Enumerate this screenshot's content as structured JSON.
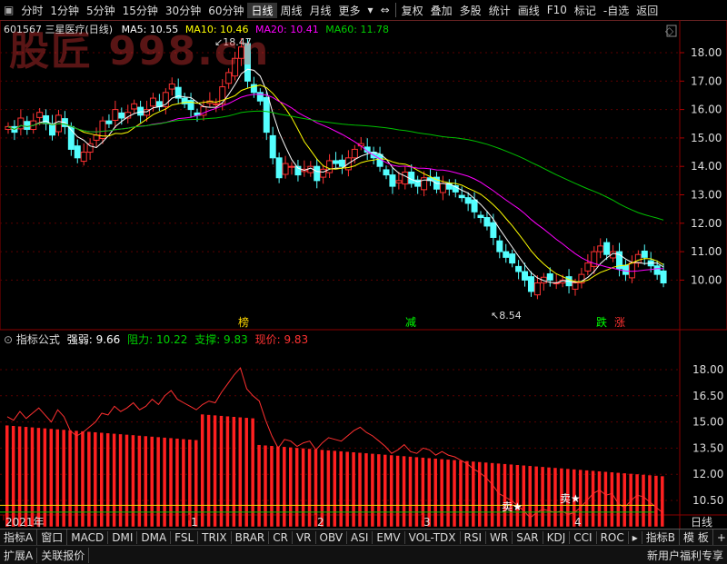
{
  "toolbar": {
    "tabs": [
      "分时",
      "1分钟",
      "5分钟",
      "15分钟",
      "30分钟",
      "60分钟",
      "日线",
      "周线",
      "月线",
      "更多"
    ],
    "active_tab": "日线",
    "right_buttons": [
      "复权",
      "叠加",
      "多股",
      "统计",
      "画线",
      "F10",
      "标记",
      "-自选",
      "返回"
    ]
  },
  "watermark": "股匠 998.cn",
  "stock": {
    "code": "601567",
    "name": "三星医疗(日线)"
  },
  "ma": {
    "ma5_label": "MA5: 10.55",
    "ma10_label": "MA10: 10.46",
    "ma20_label": "MA20: 10.41",
    "ma60_label": "MA60: 11.78"
  },
  "price_axis": [
    "18.00",
    "17.00",
    "16.00",
    "15.00",
    "14.00",
    "13.00",
    "12.00",
    "11.00",
    "10.00"
  ],
  "annotations": {
    "high": "18.47",
    "low": "8.54"
  },
  "signals": [
    "榜",
    "减",
    "跌",
    "涨"
  ],
  "indicator": {
    "name": "指标公式",
    "strength_label": "强弱: 9.66",
    "resistance_label": "阻力: 10.22",
    "support_label": "支撑: 9.83",
    "price_label": "现价: 9.83",
    "axis": [
      "18.00",
      "16.50",
      "15.00",
      "13.50",
      "12.00",
      "10.50"
    ],
    "sell_labels": [
      "卖★",
      "卖★"
    ]
  },
  "time_axis": [
    "2021年",
    "1",
    "2",
    "3",
    "4"
  ],
  "period_label": "日线",
  "bottom_tabs": [
    "指标A",
    "窗口",
    "MACD",
    "DMI",
    "DMA",
    "FSL",
    "TRIX",
    "BRAR",
    "CR",
    "VR",
    "OBV",
    "ASI",
    "EMV",
    "VOL-TDX",
    "RSI",
    "WR",
    "SAR",
    "KDJ",
    "CCI",
    "ROC",
    "指标B",
    "模 板"
  ],
  "status": {
    "expand": "扩展A",
    "link": "关联报价",
    "promo": "新用户福利专享"
  },
  "colors": {
    "up": "#ff3232",
    "down": "#54ffff",
    "ma5": "#ffffff",
    "ma10": "#ffff00",
    "ma20": "#ff00ff",
    "ma60": "#00c000"
  }
}
